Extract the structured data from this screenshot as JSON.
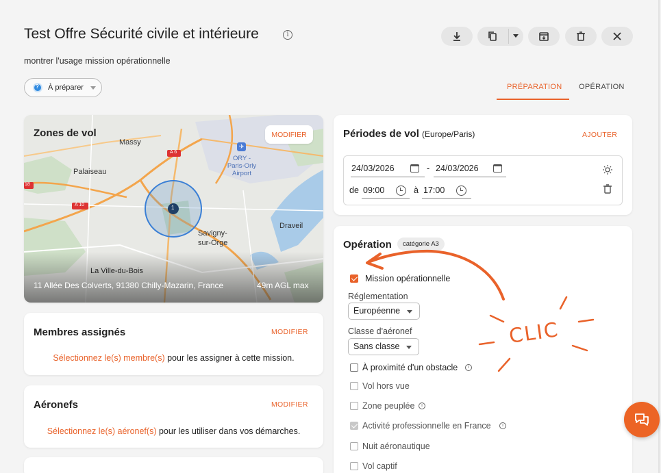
{
  "header": {
    "title": "Test Offre Sécurité civile et intérieure",
    "subtitle": "montrer l'usage mission opérationnelle"
  },
  "toolbar": {
    "icons": [
      "download-icon",
      "copy-icon",
      "chevron-down-icon",
      "archive-icon",
      "trash-icon",
      "close-icon"
    ]
  },
  "status": {
    "label": "À préparer"
  },
  "tabs": [
    {
      "label": "PRÉPARATION",
      "active": true
    },
    {
      "label": "OPÉRATION",
      "active": false
    }
  ],
  "flight_zones": {
    "title": "Zones de vol",
    "action": "MODIFIER",
    "map_labels": [
      "Massy",
      "Palaiseau",
      "ORY - Paris-Orly Airport",
      "Savigny-sur-Orge",
      "Draveil",
      "La Ville-du-Bois",
      "A 6",
      "A 10",
      "18"
    ],
    "marker_count": "1",
    "address": "11 Allée Des Colverts, 91380 Chilly-Mazarin, France",
    "altitude": "49m AGL max"
  },
  "members": {
    "title": "Membres assignés",
    "action": "MODIFIER",
    "link_text": "Sélectionnez le(s) membre(s)",
    "rest_text": " pour les assigner à cette mission."
  },
  "aircraft": {
    "title": "Aéronefs",
    "action": "MODIFIER",
    "link_text": "Sélectionnez le(s) aéronef(s)",
    "rest_text": " pour les utiliser dans vos démarches."
  },
  "flight_periods": {
    "title": "Périodes de vol",
    "timezone": "(Europe/Paris)",
    "action": "AJOUTER",
    "start_date": "24/03/2026",
    "separator": "-",
    "end_date": "24/03/2026",
    "from_label": "de",
    "from_time": "09:00",
    "to_label": "à",
    "to_time": "17:00"
  },
  "operation": {
    "title": "Opération",
    "category": "catégorie A3",
    "mission_checkbox": {
      "label": "Mission opérationnelle",
      "checked": true
    },
    "regulation_label": "Réglementation",
    "regulation_value": "Européenne",
    "aircraft_class_label": "Classe d'aéronef",
    "aircraft_class_value": "Sans classe",
    "options": [
      {
        "label": "À proximité d'un obstacle",
        "checked": false,
        "info": true
      },
      {
        "label": "Vol hors vue",
        "checked": false,
        "info": false
      },
      {
        "label": "Zone peuplée",
        "checked": false,
        "info": true
      },
      {
        "label": "Activité professionnelle en France",
        "checked": true,
        "info": true
      },
      {
        "label": "Nuit aéronautique",
        "checked": false,
        "info": false
      },
      {
        "label": "Vol captif",
        "checked": false,
        "info": false
      }
    ]
  },
  "annotation": {
    "text": "CLIC",
    "color": "#e9622a"
  },
  "colors": {
    "accent": "#e9622a",
    "status_blue": "#2f8ae0"
  }
}
